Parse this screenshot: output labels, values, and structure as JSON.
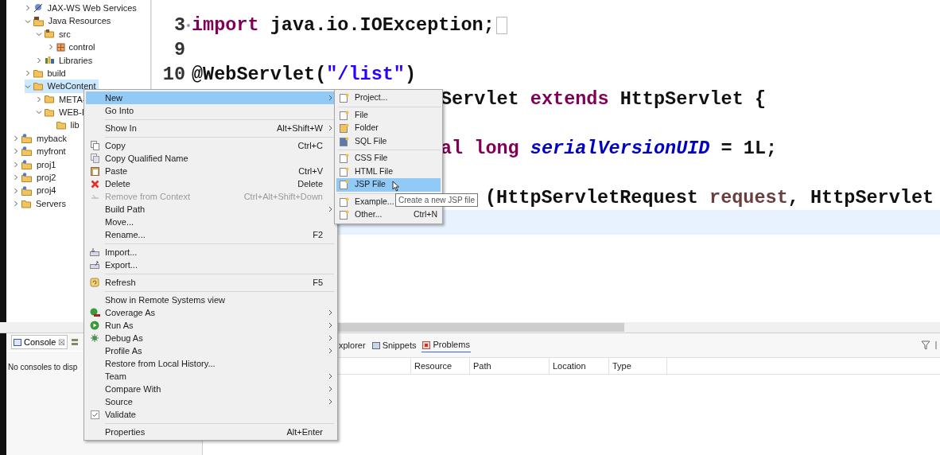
{
  "project_tree": {
    "open_project_children": [
      {
        "label": "JAX-WS Web Services",
        "kind": "services",
        "expanded": false,
        "selected": false
      },
      {
        "label": "Java Resources",
        "kind": "java_resources",
        "expanded": true,
        "selected": false,
        "children": [
          {
            "label": "src",
            "kind": "source_folder",
            "expanded": true,
            "selected": false,
            "children": [
              {
                "label": "control",
                "kind": "package",
                "expanded": false,
                "selected": false
              }
            ]
          },
          {
            "label": "Libraries",
            "kind": "library",
            "expanded": false,
            "selected": false
          }
        ]
      },
      {
        "label": "build",
        "kind": "folder",
        "expanded": false,
        "selected": false
      },
      {
        "label": "WebContent",
        "kind": "folder",
        "expanded": true,
        "selected": true,
        "children": [
          {
            "label": "META-",
            "kind": "folder",
            "expanded": false,
            "selected": false
          },
          {
            "label": "WEB-I",
            "kind": "folder",
            "expanded": true,
            "selected": false,
            "children": [
              {
                "label": "lib",
                "kind": "folder",
                "selected": false
              }
            ]
          }
        ]
      }
    ],
    "projects": [
      {
        "label": "myback",
        "kind": "project",
        "expanded": false,
        "selected": false
      },
      {
        "label": "myfront",
        "kind": "project",
        "expanded": false,
        "selected": false
      },
      {
        "label": "proj1",
        "kind": "project",
        "expanded": false,
        "selected": false
      },
      {
        "label": "proj2",
        "kind": "project",
        "expanded": false,
        "selected": false
      },
      {
        "label": "proj4",
        "kind": "project",
        "expanded": false,
        "selected": false
      },
      {
        "label": "Servers",
        "kind": "folder",
        "expanded": false,
        "selected": false
      }
    ]
  },
  "editor": {
    "lines": [
      {
        "kind": "full",
        "number": "3",
        "folded": true,
        "segments": [
          {
            "kind": "keyword",
            "text": "import"
          },
          {
            "kind": "plain",
            "text": " java.io.IOException;"
          }
        ]
      },
      {
        "kind": "full",
        "number": "9"
      },
      {
        "kind": "full",
        "number": "10",
        "segments": [
          {
            "kind": "plain",
            "text": "@WebServlet("
          },
          {
            "kind": "string",
            "text": "\"/list\""
          },
          {
            "kind": "plain",
            "text": ")"
          }
        ]
      },
      {
        "kind": "partial",
        "segments": [
          {
            "kind": "plain",
            "text": "Servlet "
          },
          {
            "kind": "keyword",
            "text": "extends"
          },
          {
            "kind": "plain",
            "text": " HttpServlet {"
          }
        ]
      },
      {
        "kind": "blank"
      },
      {
        "kind": "partial",
        "segments": [
          {
            "kind": "keyword",
            "text": "al long "
          },
          {
            "kind": "field",
            "text": "serialVersionUID"
          },
          {
            "kind": "plain",
            "text": " = 1L;"
          }
        ]
      },
      {
        "kind": "blank"
      },
      {
        "kind": "covered",
        "segments": [
          {
            "kind": "plain",
            "text": "(HttpServletRequest "
          },
          {
            "kind": "param",
            "text": "request"
          },
          {
            "kind": "plain",
            "text": ", HttpServlet"
          }
        ]
      },
      {
        "kind": "current"
      }
    ]
  },
  "console_view": {
    "tabs": [
      {
        "label": "Console",
        "selected": true,
        "close": "☒"
      }
    ],
    "message": "No consoles to disp"
  },
  "problems_view": {
    "tabs": [
      {
        "label": "xplorer",
        "selected": false
      },
      {
        "label": "Snippets",
        "selected": false
      },
      {
        "label": "Problems",
        "selected": true
      }
    ],
    "columns": [
      "Resource",
      "Path",
      "Location",
      "Type"
    ]
  },
  "context_menu": {
    "sections": [
      [
        {
          "label": "New",
          "submenu": true,
          "disabled": false,
          "selected": true
        },
        {
          "label": "Go Into",
          "submenu": false,
          "disabled": false,
          "selected": false
        }
      ],
      [
        {
          "label": "Show In",
          "shortcut": "Alt+Shift+W",
          "submenu": true,
          "disabled": false,
          "selected": false
        }
      ],
      [
        {
          "label": "Copy",
          "shortcut": "Ctrl+C",
          "submenu": false,
          "disabled": false,
          "selected": false
        },
        {
          "label": "Copy Qualified Name",
          "submenu": false,
          "disabled": false,
          "selected": false
        },
        {
          "label": "Paste",
          "shortcut": "Ctrl+V",
          "submenu": false,
          "disabled": false,
          "selected": false
        },
        {
          "label": "Delete",
          "shortcut": "Delete",
          "submenu": false,
          "disabled": false,
          "selected": false
        },
        {
          "label": "Remove from Context",
          "shortcut": "Ctrl+Alt+Shift+Down",
          "submenu": false,
          "disabled": true,
          "selected": false
        },
        {
          "label": "Build Path",
          "submenu": true,
          "disabled": false,
          "selected": false
        },
        {
          "label": "Move...",
          "submenu": false,
          "disabled": false,
          "selected": false
        },
        {
          "label": "Rename...",
          "shortcut": "F2",
          "submenu": false,
          "disabled": false,
          "selected": false
        }
      ],
      [
        {
          "label": "Import...",
          "submenu": false,
          "disabled": false,
          "selected": false
        },
        {
          "label": "Export...",
          "submenu": false,
          "disabled": false,
          "selected": false
        }
      ],
      [
        {
          "label": "Refresh",
          "shortcut": "F5",
          "submenu": false,
          "disabled": false,
          "selected": false
        }
      ],
      [
        {
          "label": "Show in Remote Systems view",
          "submenu": false,
          "disabled": false,
          "selected": false
        },
        {
          "label": "Coverage As",
          "submenu": true,
          "disabled": false,
          "selected": false
        },
        {
          "label": "Run As",
          "submenu": true,
          "disabled": false,
          "selected": false
        },
        {
          "label": "Debug As",
          "submenu": true,
          "disabled": false,
          "selected": false
        },
        {
          "label": "Profile As",
          "submenu": true,
          "disabled": false,
          "selected": false
        },
        {
          "label": "Restore from Local History...",
          "submenu": false,
          "disabled": false,
          "selected": false
        },
        {
          "label": "Team",
          "submenu": true,
          "disabled": false,
          "selected": false
        },
        {
          "label": "Compare With",
          "submenu": true,
          "disabled": false,
          "selected": false
        },
        {
          "label": "Source",
          "submenu": true,
          "disabled": false,
          "selected": false
        },
        {
          "label": "Validate",
          "submenu": false,
          "disabled": false,
          "selected": false
        }
      ],
      [
        {
          "label": "Properties",
          "shortcut": "Alt+Enter",
          "submenu": false,
          "disabled": false,
          "selected": false
        }
      ]
    ]
  },
  "new_submenu": {
    "sections": [
      [
        {
          "label": "Project...",
          "selected": false
        }
      ],
      [
        {
          "label": "File",
          "selected": false
        },
        {
          "label": "Folder",
          "selected": false
        },
        {
          "label": "SQL File",
          "selected": false
        }
      ],
      [
        {
          "label": "CSS File",
          "selected": false
        },
        {
          "label": "HTML File",
          "selected": false
        },
        {
          "label": "JSP File",
          "selected": true
        }
      ],
      [
        {
          "label": "Example...",
          "selected": false
        },
        {
          "label": "Other...",
          "shortcut": "Ctrl+N",
          "selected": false
        }
      ]
    ]
  },
  "tooltip": "Create a new JSP file"
}
